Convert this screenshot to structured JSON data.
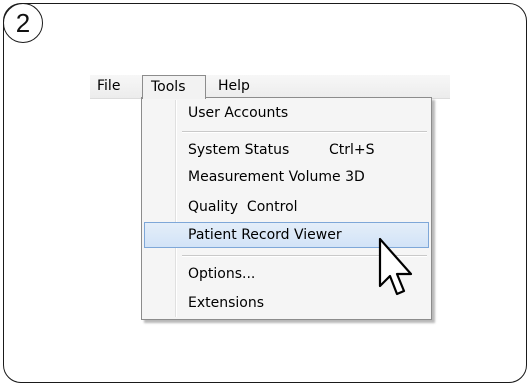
{
  "step_number": "2",
  "menubar": {
    "items": [
      {
        "label": "File"
      },
      {
        "label": "Tools"
      },
      {
        "label": "Help"
      }
    ]
  },
  "tools_menu": {
    "items": [
      {
        "label": "User Accounts",
        "shortcut": ""
      },
      {
        "label": "System Status",
        "shortcut": "Ctrl+S"
      },
      {
        "label": "Measurement Volume 3D",
        "shortcut": ""
      },
      {
        "label": "Quality  Control",
        "shortcut": ""
      },
      {
        "label": "Patient Record Viewer",
        "shortcut": "",
        "highlighted": true
      },
      {
        "label": "Options...",
        "shortcut": ""
      },
      {
        "label": "Extensions",
        "shortcut": ""
      }
    ]
  },
  "colors": {
    "highlight_border": "#7ea7d8",
    "highlight_fill": "#d9e7f8",
    "menu_background": "#f5f5f5"
  },
  "icons": [
    "arrow-cursor-icon"
  ]
}
